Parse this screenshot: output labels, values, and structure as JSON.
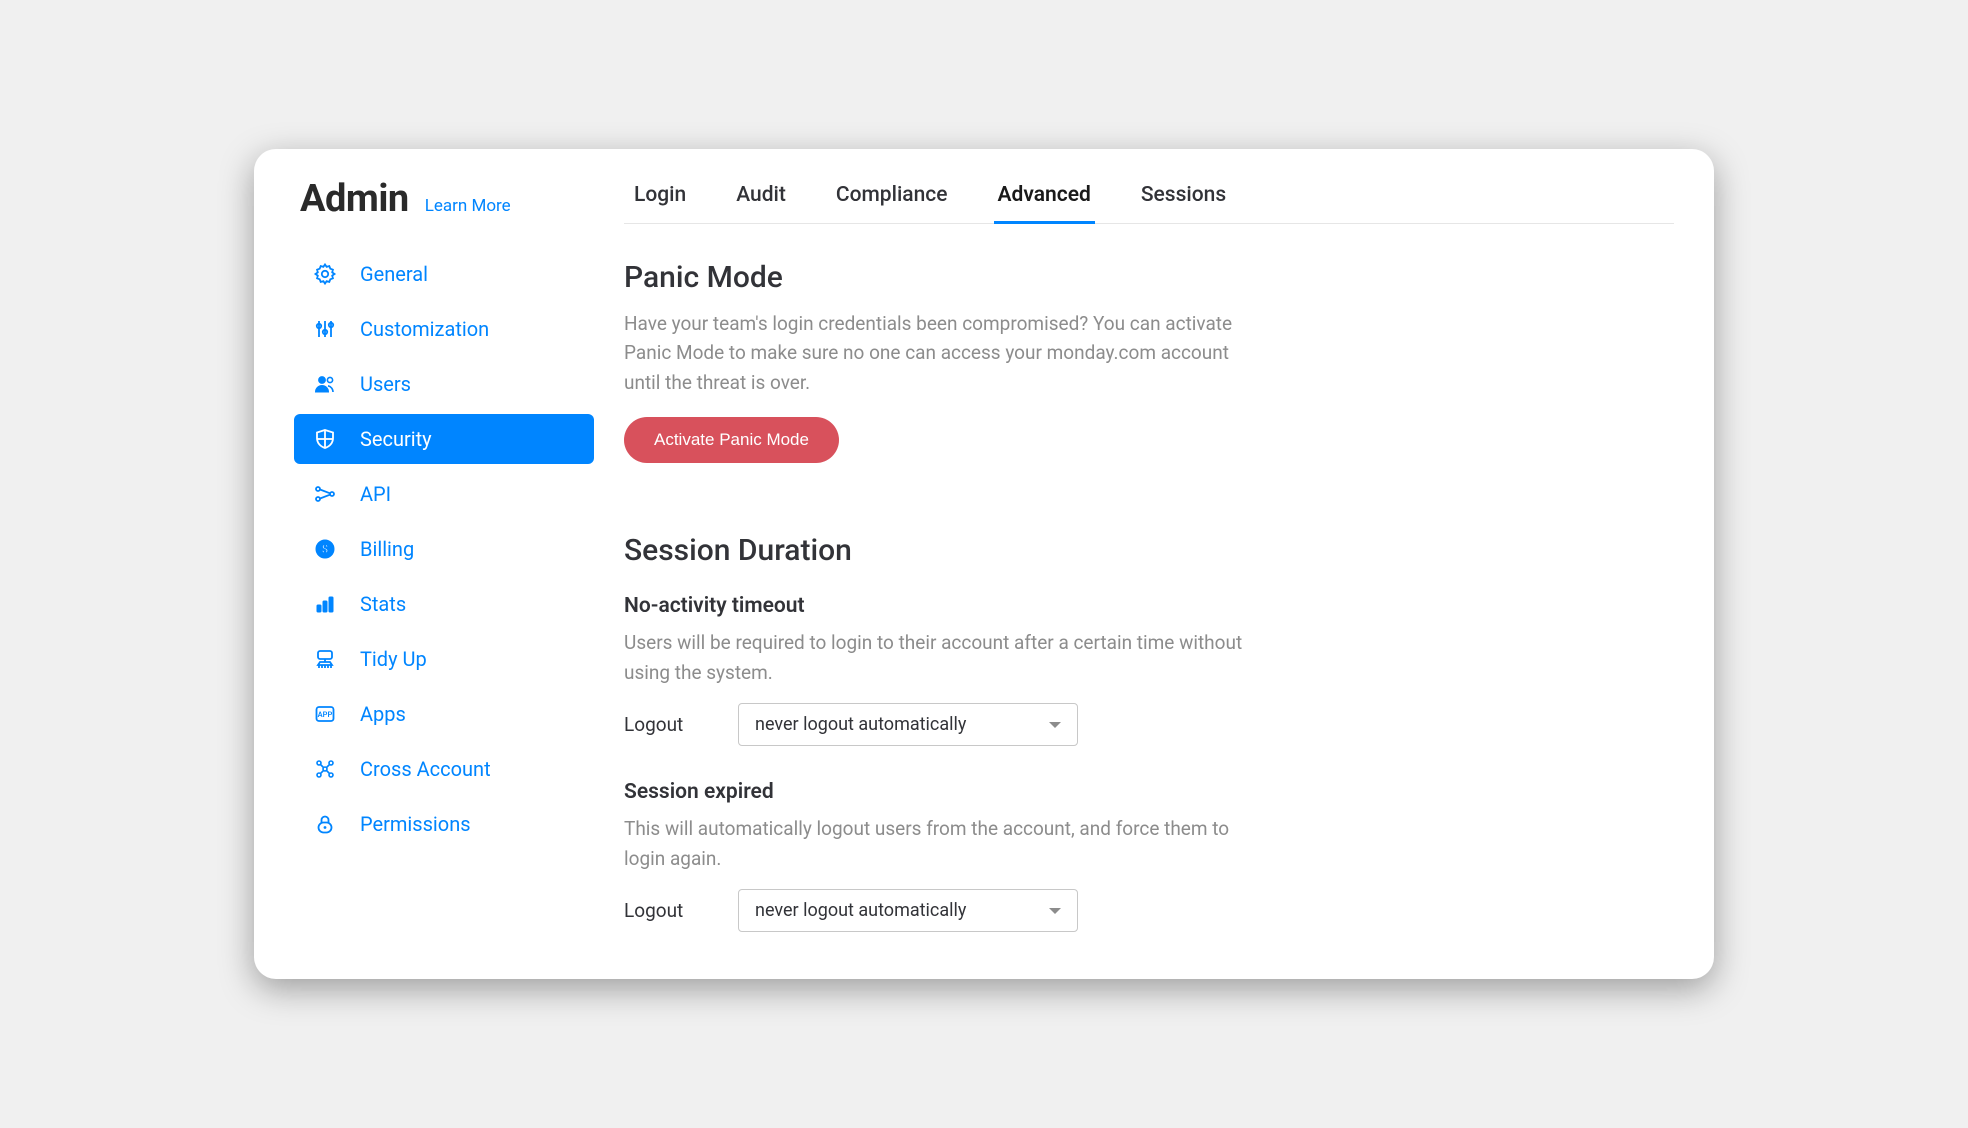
{
  "header": {
    "title": "Admin",
    "learn_more": "Learn More"
  },
  "sidebar": {
    "items": [
      {
        "label": "General",
        "icon": "gear-icon"
      },
      {
        "label": "Customization",
        "icon": "sliders-icon"
      },
      {
        "label": "Users",
        "icon": "users-icon"
      },
      {
        "label": "Security",
        "icon": "shield-icon",
        "active": true
      },
      {
        "label": "API",
        "icon": "api-icon"
      },
      {
        "label": "Billing",
        "icon": "billing-icon"
      },
      {
        "label": "Stats",
        "icon": "stats-icon"
      },
      {
        "label": "Tidy Up",
        "icon": "broom-icon"
      },
      {
        "label": "Apps",
        "icon": "apps-icon"
      },
      {
        "label": "Cross Account",
        "icon": "cross-account-icon"
      },
      {
        "label": "Permissions",
        "icon": "lock-icon"
      }
    ]
  },
  "tabs": [
    {
      "label": "Login"
    },
    {
      "label": "Audit"
    },
    {
      "label": "Compliance"
    },
    {
      "label": "Advanced",
      "active": true
    },
    {
      "label": "Sessions"
    }
  ],
  "panic": {
    "title": "Panic Mode",
    "desc": "Have your team's login credentials been compromised? You can activate Panic Mode to make sure no one can access your monday.com account until the threat is over.",
    "button": "Activate Panic Mode"
  },
  "session": {
    "title": "Session Duration",
    "no_activity": {
      "title": "No-activity timeout",
      "desc": "Users will be required to login to their account after a certain time without using the system.",
      "label": "Logout",
      "value": "never logout automatically"
    },
    "expired": {
      "title": "Session expired",
      "desc": "This will automatically logout users from the account, and force them to login again.",
      "label": "Logout",
      "value": "never logout automatically"
    }
  },
  "colors": {
    "accent": "#0085ff",
    "danger": "#d8515c",
    "text_muted": "#8c8c8c"
  }
}
